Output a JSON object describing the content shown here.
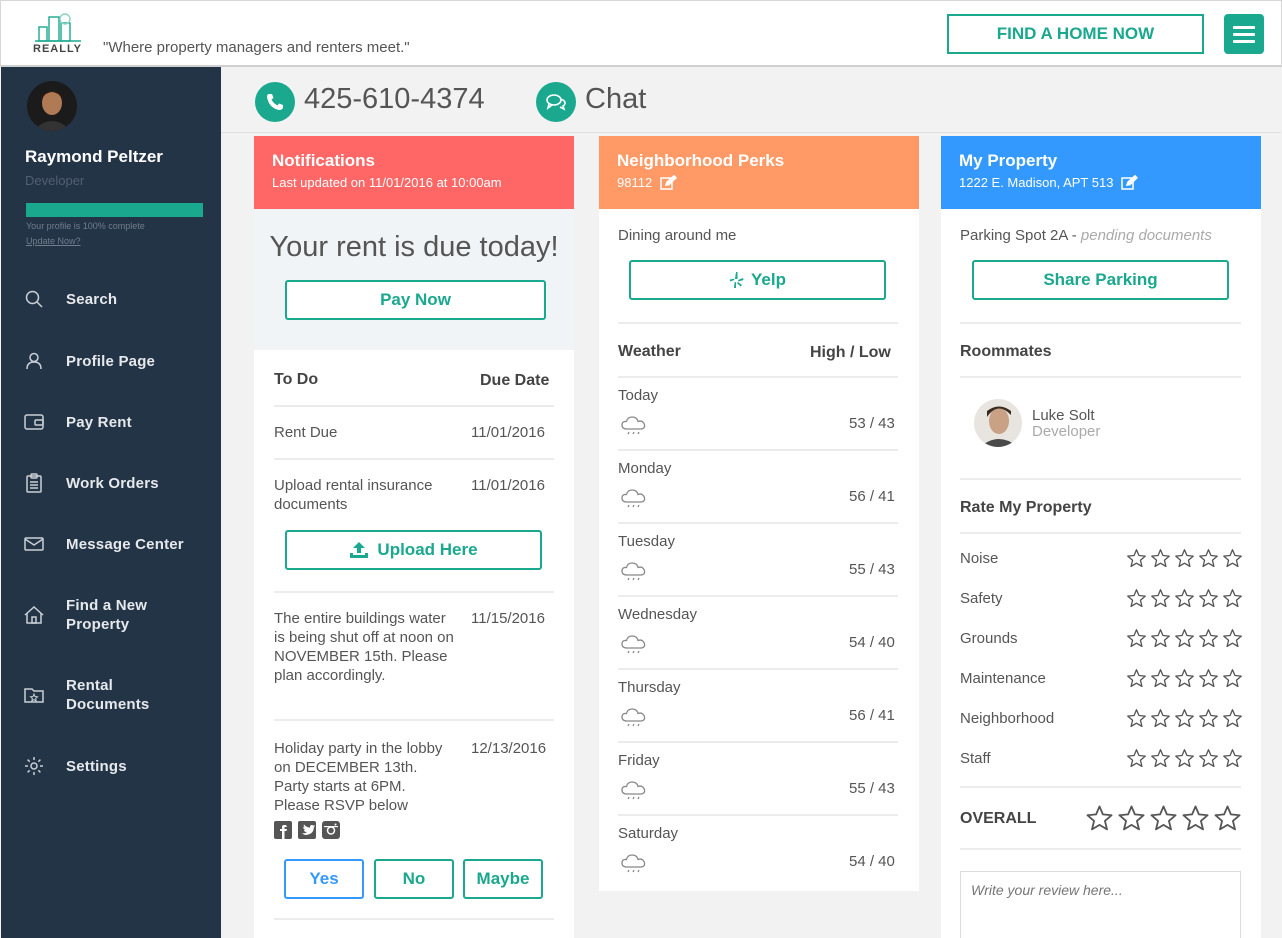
{
  "header": {
    "logo_text": "REALLY",
    "tagline": "\"Where property managers and renters meet.\"",
    "find_home_label": "FIND A HOME NOW",
    "menu_icon": "hamburger-icon"
  },
  "sidebar": {
    "user_name": "Raymond Peltzer",
    "user_role": "Developer",
    "profile_complete": 1.0,
    "profile_note": "Your profile is 100% complete",
    "update_link": "Update Now?",
    "items": [
      {
        "label": "Search",
        "icon": "search-icon"
      },
      {
        "label": "Profile Page",
        "icon": "user-icon"
      },
      {
        "label": "Pay Rent",
        "icon": "wallet-icon"
      },
      {
        "label": "Work Orders",
        "icon": "clipboard-icon"
      },
      {
        "label": "Message Center",
        "icon": "envelope-icon"
      },
      {
        "label": "Find a New Property",
        "icon": "home-icon"
      },
      {
        "label": "Rental Documents",
        "icon": "folder-icon"
      },
      {
        "label": "Settings",
        "icon": "gear-icon"
      }
    ]
  },
  "contact": {
    "phone": "425-610-4374",
    "chat_label": "Chat"
  },
  "notifications": {
    "title": "Notifications",
    "subtitle": "Last updated on 11/01/2016 at 10:00am",
    "rent_message": "Your rent is due today!",
    "pay_now_label": "Pay Now",
    "todo_header": "To Do",
    "due_header": "Due Date",
    "items": [
      {
        "text": "Rent Due",
        "date": "11/01/2016"
      },
      {
        "text": "Upload rental insurance documents",
        "date": "11/01/2016"
      },
      {
        "text": "The entire buildings water is being shut off at noon on NOVEMBER 15th. Please plan accordingly.",
        "date": "11/15/2016"
      },
      {
        "text": "Holiday party in the lobby on DECEMBER 13th. Party starts at 6PM. Please RSVP below",
        "date": "12/13/2016"
      }
    ],
    "upload_label": "Upload Here",
    "rsvp": {
      "yes": "Yes",
      "no": "No",
      "maybe": "Maybe"
    }
  },
  "perks": {
    "title": "Neighborhood Perks",
    "zip": "98112",
    "dining_label": "Dining around me",
    "yelp_label": "Yelp",
    "weather_header": "Weather",
    "highlow_header": "High / Low",
    "days": [
      {
        "day": "Today",
        "temps": "53 / 43"
      },
      {
        "day": "Monday",
        "temps": "56 / 41"
      },
      {
        "day": "Tuesday",
        "temps": "55 / 43"
      },
      {
        "day": "Wednesday",
        "temps": "54 / 40"
      },
      {
        "day": "Thursday",
        "temps": "56 / 41"
      },
      {
        "day": "Friday",
        "temps": "55 / 43"
      },
      {
        "day": "Saturday",
        "temps": "54 / 40"
      }
    ]
  },
  "property": {
    "title": "My Property",
    "address": "1222 E. Madison, APT 513",
    "parking_label": "Parking Spot 2A - ",
    "parking_status": "pending documents",
    "share_label": "Share Parking",
    "roommates_header": "Roommates",
    "roommate_name": "Luke Solt",
    "roommate_role": "Developer",
    "rate_header": "Rate My Property",
    "ratings": [
      "Noise",
      "Safety",
      "Grounds",
      "Maintenance",
      "Neighborhood",
      "Staff"
    ],
    "overall_label": "OVERALL",
    "review_placeholder": "Write your review here..."
  },
  "colors": {
    "accent": "#1aa88e",
    "sidebar": "#243447",
    "notifications": "#ff6666",
    "perks": "#ff9966",
    "property": "#3399ff"
  }
}
